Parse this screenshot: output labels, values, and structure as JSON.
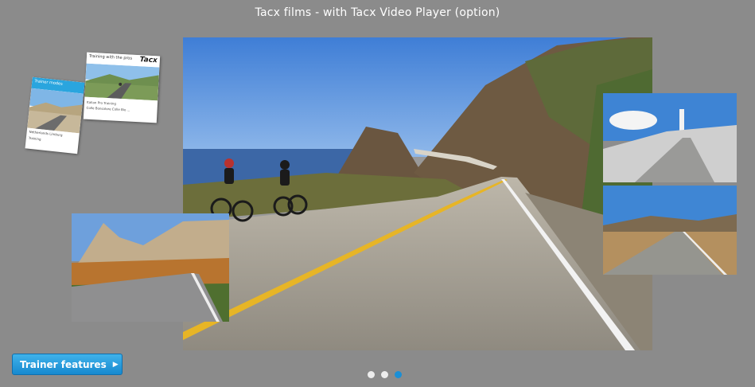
{
  "header": {
    "title": "Tacx films - with Tacx Video Player (option)"
  },
  "dvds": {
    "back": {
      "title": "Trainer modes",
      "subtitle": "Netherlands Limburg",
      "caption": "Training"
    },
    "front": {
      "title": "Training with the pros",
      "brand": "Tacx",
      "subtitle": "Italian Pro Training",
      "caption": "Colle Bonsalore Colle Bio ..."
    }
  },
  "cta": {
    "label": "Trainer features",
    "arrow": "▶"
  },
  "carousel": {
    "count": 3,
    "active_index": 2
  },
  "colors": {
    "accent": "#1a8fd6",
    "background": "#8b8b8b"
  }
}
